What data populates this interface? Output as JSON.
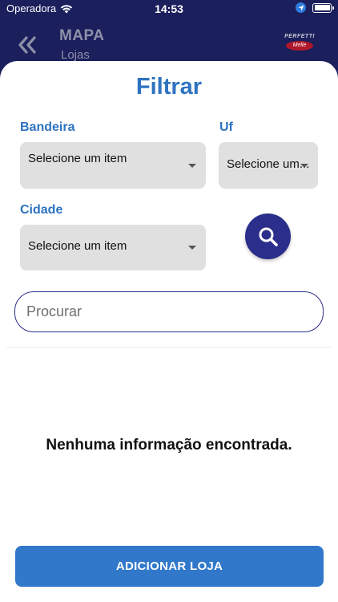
{
  "status_bar": {
    "carrier": "Operadora",
    "time": "14:53"
  },
  "header": {
    "title": "MAPA",
    "subtitle": "Lojas",
    "brand_top": "PERFETTI",
    "brand_oval": "Melle"
  },
  "filter": {
    "title": "Filtrar",
    "bandeira": {
      "label": "Bandeira",
      "value": "Selecione um item"
    },
    "uf": {
      "label": "Uf",
      "value": "Selecione um..."
    },
    "cidade": {
      "label": "Cidade",
      "value": "Selecione um item"
    }
  },
  "search": {
    "placeholder": "Procurar"
  },
  "empty_message": "Nenhuma informação encontrada.",
  "add_button_label": "ADICIONAR LOJA",
  "colors": {
    "header_bg": "#1b1f5c",
    "accent_blue": "#2e73c0",
    "search_button": "#2b2e8a",
    "add_button": "#3178cb",
    "dropdown_bg": "#e0e0e0"
  }
}
